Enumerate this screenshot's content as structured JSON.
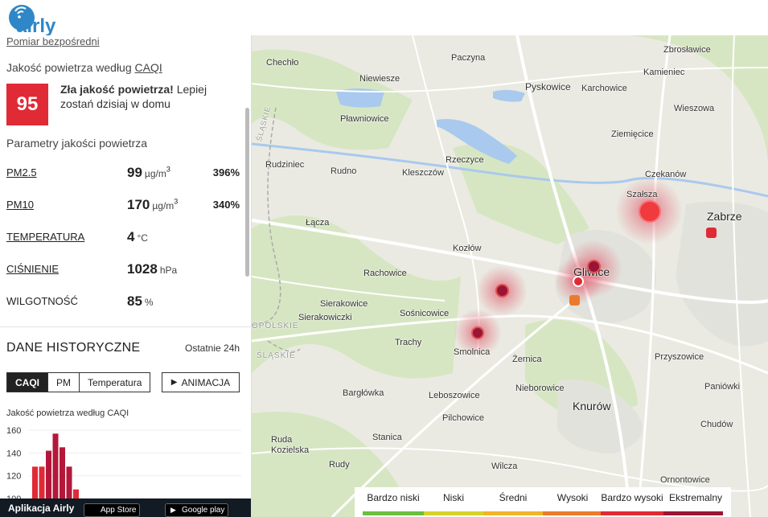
{
  "header": {
    "logo_text": "airly"
  },
  "sidebar": {
    "measure_link": "Pomiar bezpośredni",
    "caqi_heading_prefix": "Jakość powietrza według ",
    "caqi_heading_link": "CAQI",
    "caqi_value": "95",
    "caqi_message_bold": "Zła jakość powietrza!",
    "caqi_message_rest": " Lepiej zostań dzisiaj w domu",
    "params_heading": "Parametry jakości powietrza",
    "params": [
      {
        "name": "PM2.5",
        "value": "99",
        "unit": "µg/m",
        "unit_sup": "3",
        "percent": "396%"
      },
      {
        "name": "PM10",
        "value": "170",
        "unit": "µg/m",
        "unit_sup": "3",
        "percent": "340%"
      },
      {
        "name": "TEMPERATURA",
        "value": "4",
        "unit": "°C",
        "unit_sup": "",
        "percent": ""
      },
      {
        "name": "CIŚNIENIE",
        "value": "1028",
        "unit": "hPa",
        "unit_sup": "",
        "percent": ""
      },
      {
        "name": "WILGOTNOŚĆ",
        "value": "85",
        "unit": "%",
        "unit_sup": "",
        "percent": ""
      }
    ],
    "history_title": "DANE HISTORYCZNE",
    "history_range": "Ostatnie 24h",
    "tabs": [
      "CAQI",
      "PM",
      "Temperatura"
    ],
    "active_tab": "CAQI",
    "animation_button": "ANIMACJA",
    "chart_title": "Jakość powietrza według CAQI",
    "appbar_text": "Aplikacja Airly",
    "store_apple": "App Store",
    "store_google": "Google play"
  },
  "chart_data": {
    "type": "bar",
    "title": "Jakość powietrza według CAQI",
    "y_ticks": [
      160,
      140,
      120,
      100
    ],
    "ylim": [
      100,
      165
    ],
    "values": [
      128,
      128,
      142,
      157,
      145,
      128,
      108
    ],
    "colors": [
      "#e02a35",
      "#e02a35",
      "#b3183a",
      "#b3183a",
      "#b3183a",
      "#b3183a",
      "#e02a35"
    ]
  },
  "map": {
    "places": [
      {
        "name": "Chechło"
      },
      {
        "name": "Paczyna"
      },
      {
        "name": "Zbrosławice"
      },
      {
        "name": "Niewiesze"
      },
      {
        "name": "Kamieniec"
      },
      {
        "name": "Pyskowice"
      },
      {
        "name": "Karchowice"
      },
      {
        "name": "Wieszowa"
      },
      {
        "name": "Pławniowice"
      },
      {
        "name": "Ziemięcice"
      },
      {
        "name": "Rzeczyce"
      },
      {
        "name": "Rudziniec"
      },
      {
        "name": "Rudno"
      },
      {
        "name": "Kleszczów"
      },
      {
        "name": "Czekanów"
      },
      {
        "name": "Szałsza"
      },
      {
        "name": "Zabrze"
      },
      {
        "name": "Łącza"
      },
      {
        "name": "Kozłów"
      },
      {
        "name": "Rachowice"
      },
      {
        "name": "Gliwice"
      },
      {
        "name": "Sierakowice"
      },
      {
        "name": "Sośnicowice"
      },
      {
        "name": "Sierakowiczki"
      },
      {
        "name": "Trachy"
      },
      {
        "name": "Smolnica"
      },
      {
        "name": "Żernica"
      },
      {
        "name": "Przyszowice"
      },
      {
        "name": "Bargłówka"
      },
      {
        "name": "Leboszowice"
      },
      {
        "name": "Nieborowice"
      },
      {
        "name": "Paniówki"
      },
      {
        "name": "Knurów"
      },
      {
        "name": "Pilchowice"
      },
      {
        "name": "Chudów"
      },
      {
        "name": "Stanica"
      },
      {
        "name": "Ruda Kozielska"
      },
      {
        "name": "Rudy"
      },
      {
        "name": "Wilcza"
      },
      {
        "name": "Ornontowice"
      },
      {
        "name": "ŚLĄSKIE"
      },
      {
        "name": "OPOLSKIE"
      },
      {
        "name": "ŚLĄSKIE"
      }
    ]
  },
  "legend": {
    "items": [
      {
        "label": "Bardzo niski",
        "color": "#6bbf3f"
      },
      {
        "label": "Niski",
        "color": "#d6d22a"
      },
      {
        "label": "Średni",
        "color": "#f0b429"
      },
      {
        "label": "Wysoki",
        "color": "#eb7b2c"
      },
      {
        "label": "Bardzo wysoki",
        "color": "#e02a35"
      },
      {
        "label": "Ekstremalny",
        "color": "#9a1535"
      }
    ]
  },
  "colors": {
    "caqi_red": "#e02a35",
    "dark_red": "#9a1535",
    "orange": "#eb7b2c"
  }
}
